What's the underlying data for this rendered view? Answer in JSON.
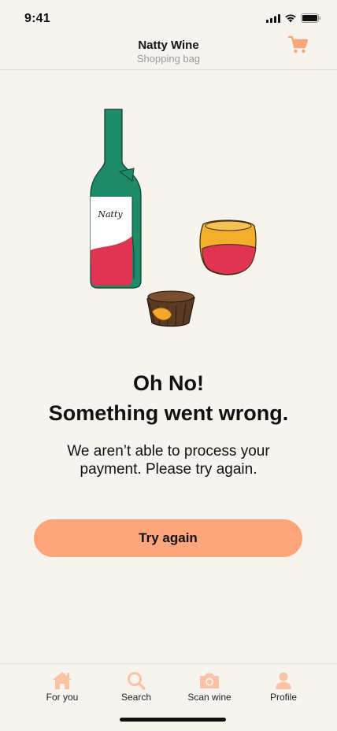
{
  "status_bar": {
    "time": "9:41"
  },
  "header": {
    "title": "Natty Wine",
    "subtitle": "Shopping bag",
    "cart_icon": "shopping-cart-icon"
  },
  "illustration": {
    "bottle_label": "Natty"
  },
  "error": {
    "title_line1": "Oh No!",
    "title_line2": "Something went wrong.",
    "message": "We aren’t able to process your payment. Please try again."
  },
  "actions": {
    "try_again_label": "Try again"
  },
  "tab_bar": {
    "items": [
      {
        "label": "For you",
        "icon": "home-icon"
      },
      {
        "label": "Search",
        "icon": "search-icon"
      },
      {
        "label": "Scan wine",
        "icon": "camera-icon"
      },
      {
        "label": "Profile",
        "icon": "profile-icon"
      }
    ]
  },
  "colors": {
    "background": "#f7f4f0",
    "accent": "#fda57a",
    "tab_icon": "#f9c3a8",
    "bottle_green": "#1e8a68",
    "wine_red": "#e03552",
    "glass_amber": "#f5ad2c",
    "chocolate": "#5a3a22"
  }
}
